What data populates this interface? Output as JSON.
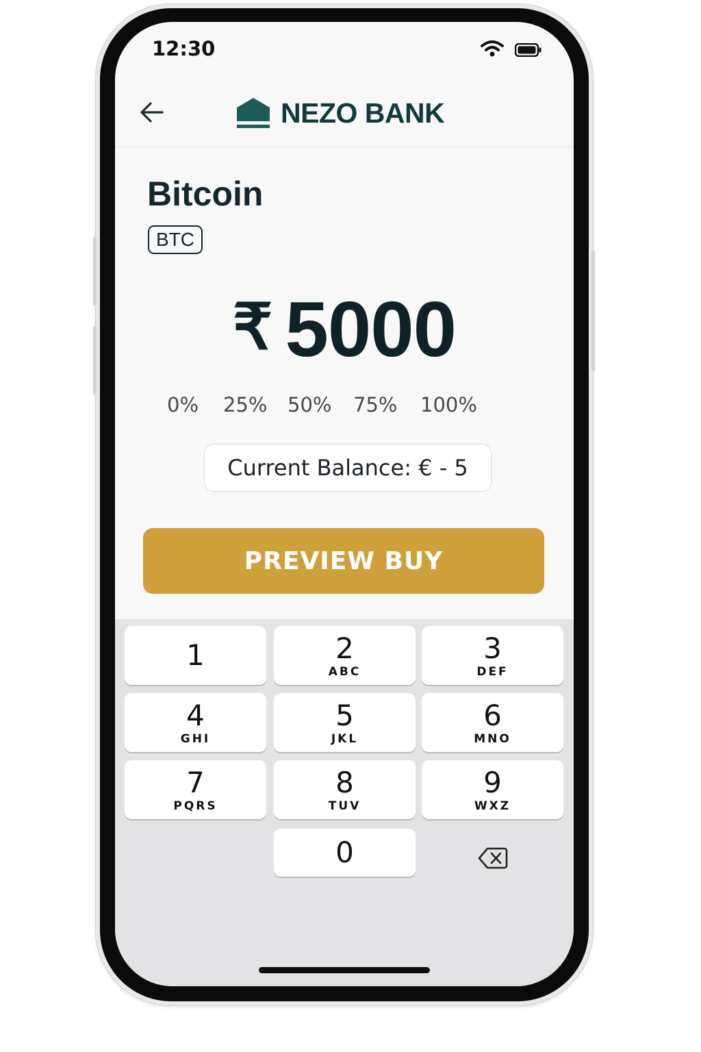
{
  "status_bar": {
    "time": "12:30",
    "wifi_icon": "wifi-icon",
    "battery_icon": "battery-icon"
  },
  "header": {
    "back_icon": "arrow-left-icon",
    "logo_icon": "bank-house-icon",
    "brand_name": "NEZO BANK"
  },
  "asset": {
    "name": "Bitcoin",
    "ticker": "BTC"
  },
  "amount": {
    "currency_symbol": "₹",
    "value": "5000"
  },
  "percent_options": [
    "0%",
    "25%",
    "50%",
    "75%",
    "100%"
  ],
  "balance": {
    "text": "Current Balance: € - 5"
  },
  "preview_button": {
    "label": "PREVIEW BUY"
  },
  "keypad": {
    "keys": [
      {
        "digit": "1",
        "letters": ""
      },
      {
        "digit": "2",
        "letters": "ABC"
      },
      {
        "digit": "3",
        "letters": "DEF"
      },
      {
        "digit": "4",
        "letters": "GHI"
      },
      {
        "digit": "5",
        "letters": "JKL"
      },
      {
        "digit": "6",
        "letters": "MNO"
      },
      {
        "digit": "7",
        "letters": "PQRS"
      },
      {
        "digit": "8",
        "letters": "TUV"
      },
      {
        "digit": "9",
        "letters": "WXZ"
      },
      {
        "digit": "0",
        "letters": ""
      }
    ],
    "delete_icon": "backspace-icon"
  },
  "colors": {
    "brand": "#0f3b3d",
    "accent_button": "#cfa03a",
    "screen_background": "#f8f8f8",
    "keypad_background": "#e3e3e6"
  }
}
